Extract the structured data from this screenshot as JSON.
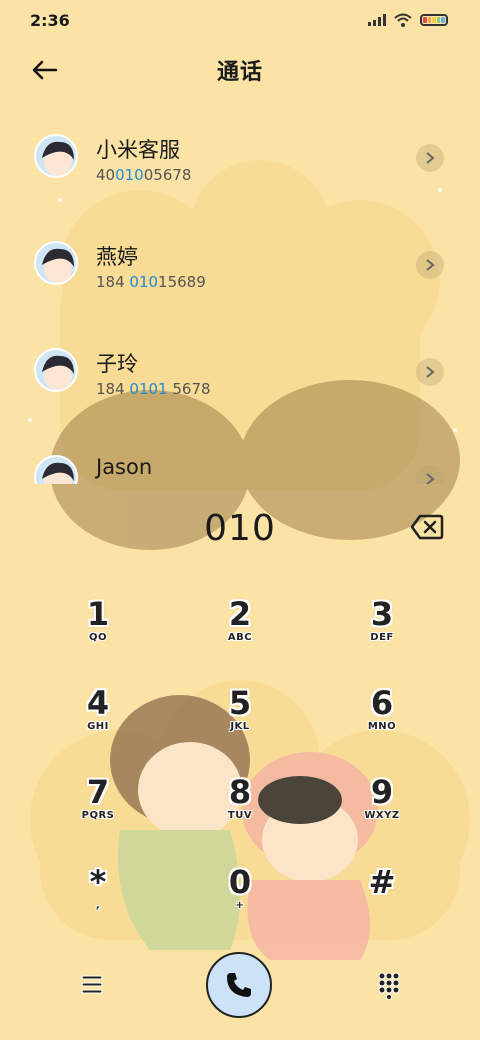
{
  "status_bar": {
    "time": "2:36"
  },
  "header": {
    "title": "通话"
  },
  "contacts": [
    {
      "name": "小米客服",
      "number_pre": "40",
      "number_hl": "010",
      "number_post": "05678"
    },
    {
      "name": "燕婷",
      "number_pre": "184 ",
      "number_hl": "010",
      "number_post": "15689"
    },
    {
      "name": "子玲",
      "number_pre": "184 ",
      "number_hl": "0101",
      "number_post": " 5678"
    },
    {
      "name": "Jason",
      "number_pre": "",
      "number_hl": "",
      "number_post": ""
    }
  ],
  "dialer": {
    "input": "010",
    "keys": [
      {
        "digit": "1",
        "letters": "QO"
      },
      {
        "digit": "2",
        "letters": "ABC"
      },
      {
        "digit": "3",
        "letters": "DEF"
      },
      {
        "digit": "4",
        "letters": "GHI"
      },
      {
        "digit": "5",
        "letters": "JKL"
      },
      {
        "digit": "6",
        "letters": "MNO"
      },
      {
        "digit": "7",
        "letters": "PQRS"
      },
      {
        "digit": "8",
        "letters": "TUV"
      },
      {
        "digit": "9",
        "letters": "WXYZ"
      },
      {
        "digit": "*",
        "letters": ","
      },
      {
        "digit": "0",
        "letters": "+"
      },
      {
        "digit": "#",
        "letters": ""
      }
    ]
  },
  "icons": {
    "back": "arrow-left-icon",
    "chevron": "chevron-right-icon",
    "backspace": "backspace-icon",
    "menu": "menu-icon",
    "call": "phone-icon",
    "keypad": "dialpad-icon"
  },
  "colors": {
    "background": "#fbe3a6",
    "highlight": "#1f8ad6",
    "call_button": "#cce3f7"
  }
}
